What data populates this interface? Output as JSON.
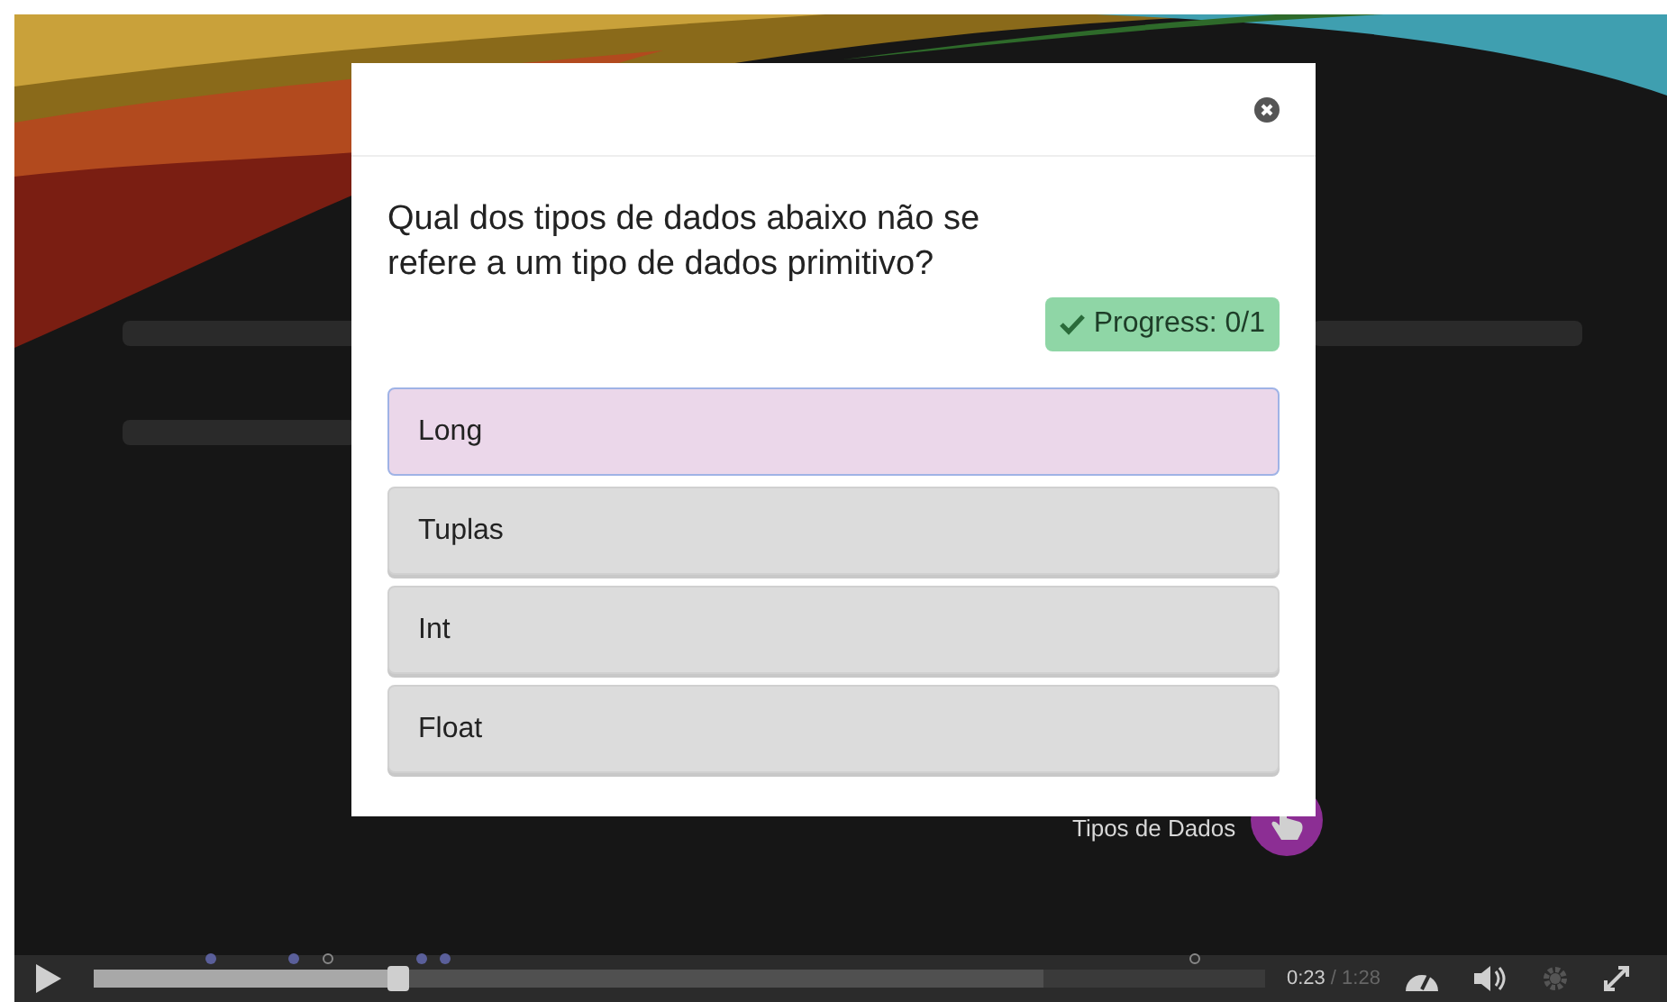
{
  "hotspot": {
    "label": "Tipos de Dados"
  },
  "dialog": {
    "question": "Qual dos tipos de dados abaixo não se refere a um tipo de dados primitivo?",
    "progress": "Progress: 0/1",
    "options": [
      {
        "label": "Long",
        "selected": true
      },
      {
        "label": "Tuplas",
        "selected": false
      },
      {
        "label": "Int",
        "selected": false
      },
      {
        "label": "Float",
        "selected": false
      }
    ]
  },
  "player": {
    "progress": {
      "level": 0.26
    },
    "buffered": {
      "level": 0.81
    },
    "markers": [
      {
        "kind": "dot"
      },
      {
        "kind": "dot"
      },
      {
        "kind": "ring"
      },
      {
        "kind": "dot"
      },
      {
        "kind": "dot"
      },
      {
        "kind": "ring"
      }
    ],
    "time": "0:23",
    "duration": "/ 1:28"
  }
}
